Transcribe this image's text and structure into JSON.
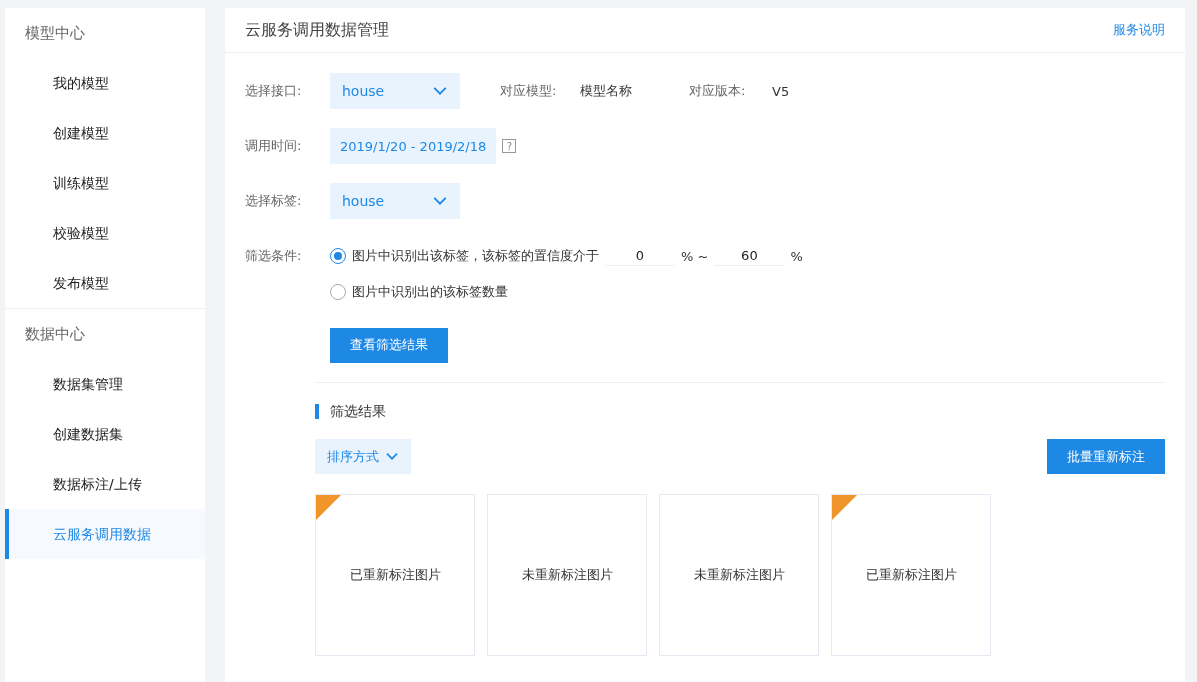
{
  "sidebar": {
    "groups": [
      {
        "title": "模型中心",
        "items": [
          {
            "label": "我的模型",
            "selected": false
          },
          {
            "label": "创建模型",
            "selected": false
          },
          {
            "label": "训练模型",
            "selected": false
          },
          {
            "label": "校验模型",
            "selected": false
          },
          {
            "label": "发布模型",
            "selected": false
          }
        ]
      },
      {
        "title": "数据中心",
        "items": [
          {
            "label": "数据集管理",
            "selected": false
          },
          {
            "label": "创建数据集",
            "selected": false
          },
          {
            "label": "数据标注/上传",
            "selected": false
          },
          {
            "label": "云服务调用数据",
            "selected": true
          }
        ]
      }
    ]
  },
  "header": {
    "title": "云服务调用数据管理",
    "link": "服务说明"
  },
  "form": {
    "interface": {
      "label": "选择接口:",
      "value": "house"
    },
    "model": {
      "label": "对应模型:",
      "value": "模型名称"
    },
    "version": {
      "label": "对应版本:",
      "value": "V5"
    },
    "time": {
      "label": "调用时间:",
      "value": "2019/1/20 - 2019/2/18",
      "help": "?"
    },
    "tag": {
      "label": "选择标签:",
      "value": "house"
    },
    "filter": {
      "label": "筛选条件:",
      "options": [
        {
          "kind": "range",
          "label": "图片中识别出该标签，该标签的置信度介于",
          "min": "0",
          "sep": "% ~",
          "max": "60",
          "unit": "%",
          "selected": true
        },
        {
          "kind": "plain",
          "label": "图片中识别出的该标签数量",
          "selected": false
        }
      ]
    },
    "submit": "查看筛选结果"
  },
  "results": {
    "title": "筛选结果",
    "sort": "排序方式",
    "batch": "批量重新标注",
    "cards": [
      {
        "label": "已重新标注图片",
        "relabeled": true
      },
      {
        "label": "未重新标注图片",
        "relabeled": false
      },
      {
        "label": "未重新标注图片",
        "relabeled": false
      },
      {
        "label": "已重新标注图片",
        "relabeled": true
      }
    ]
  }
}
